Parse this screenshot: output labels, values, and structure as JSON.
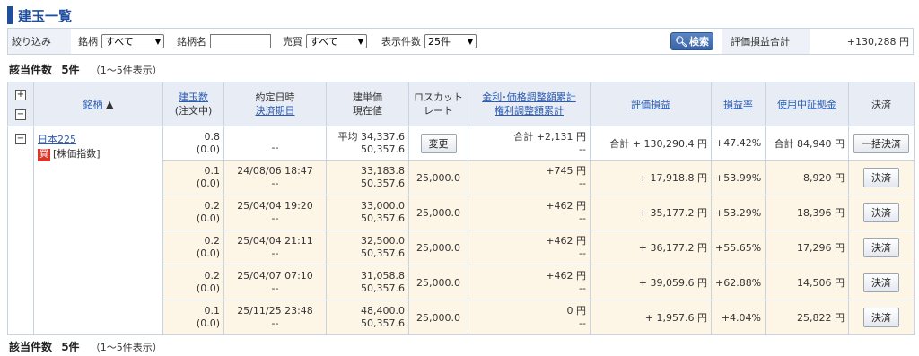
{
  "page": {
    "title": "建玉一覧"
  },
  "filter": {
    "label": "絞り込み",
    "brand_label": "銘柄",
    "brand_value": "すべて",
    "brand_name_label": "銘柄名",
    "brand_name_value": "",
    "buysell_label": "売買",
    "buysell_value": "すべて",
    "display_count_label": "表示件数",
    "display_count_value": "25件",
    "search_label": "検索",
    "total_label": "評価損益合計",
    "total_value": "+130,288 円"
  },
  "summary": {
    "count_label": "該当件数",
    "count": "5件",
    "range": "（1～5件表示）"
  },
  "table": {
    "headers": {
      "brand": "銘柄",
      "qty_top": "建玉数",
      "qty_bottom": "(注文中)",
      "date_top": "約定日時",
      "date_bottom": "決済期日",
      "price_top": "建単価",
      "price_bottom": "現在値",
      "losscut_top": "ロスカット",
      "losscut_bottom": "レート",
      "adj_top": "金利･価格調整額累計",
      "adj_bottom": "権利調整額累計",
      "pl": "評価損益",
      "plrate": "損益率",
      "margin": "使用中証拠金",
      "settle": "決済"
    },
    "summary_row": {
      "brand_link": "日本225",
      "side": "買",
      "kind": "[株価指数]",
      "qty": "0.8",
      "qty_pending": "(0.0)",
      "date": "--",
      "avg_price": "平均 34,337.6",
      "current": "50,357.6",
      "change_button": "変更",
      "adj_total": "合計 +2,131 円",
      "adj_rights": "--",
      "pl": "合計 + 130,290.4 円",
      "plrate": "+47.42%",
      "margin": "合計 84,940 円",
      "settle_all": "一括決済"
    },
    "rows": [
      {
        "qty": "0.1",
        "pending": "(0.0)",
        "date": "24/08/06 18:47",
        "due": "--",
        "price": "33,183.8",
        "current": "50,357.6",
        "losscut": "25,000.0",
        "adj": "+745 円",
        "rights": "--",
        "pl": "+ 17,918.8 円",
        "plrate": "+53.99%",
        "margin": "8,920 円",
        "settle": "決済"
      },
      {
        "qty": "0.2",
        "pending": "(0.0)",
        "date": "25/04/04 19:20",
        "due": "--",
        "price": "33,000.0",
        "current": "50,357.6",
        "losscut": "25,000.0",
        "adj": "+462 円",
        "rights": "--",
        "pl": "+ 35,177.2 円",
        "plrate": "+53.29%",
        "margin": "18,396 円",
        "settle": "決済"
      },
      {
        "qty": "0.2",
        "pending": "(0.0)",
        "date": "25/04/04 21:11",
        "due": "--",
        "price": "32,500.0",
        "current": "50,357.6",
        "losscut": "25,000.0",
        "adj": "+462 円",
        "rights": "--",
        "pl": "+ 36,177.2 円",
        "plrate": "+55.65%",
        "margin": "17,296 円",
        "settle": "決済"
      },
      {
        "qty": "0.2",
        "pending": "(0.0)",
        "date": "25/04/07 07:10",
        "due": "--",
        "price": "31,058.8",
        "current": "50,357.6",
        "losscut": "25,000.0",
        "adj": "+462 円",
        "rights": "--",
        "pl": "+ 39,059.6 円",
        "plrate": "+62.88%",
        "margin": "14,506 円",
        "settle": "決済"
      },
      {
        "qty": "0.1",
        "pending": "(0.0)",
        "date": "25/11/25 23:48",
        "due": "--",
        "price": "48,400.0",
        "current": "50,357.6",
        "losscut": "25,000.0",
        "adj": "0 円",
        "rights": "--",
        "pl": "+ 1,957.6 円",
        "plrate": "+4.04%",
        "margin": "25,822 円",
        "settle": "決済"
      }
    ]
  },
  "colors": {
    "accent": "#1f4e9c",
    "header_bg": "#e8edf5",
    "row_highlight": "#fdf5e6",
    "buy_badge": "#d9362b"
  }
}
